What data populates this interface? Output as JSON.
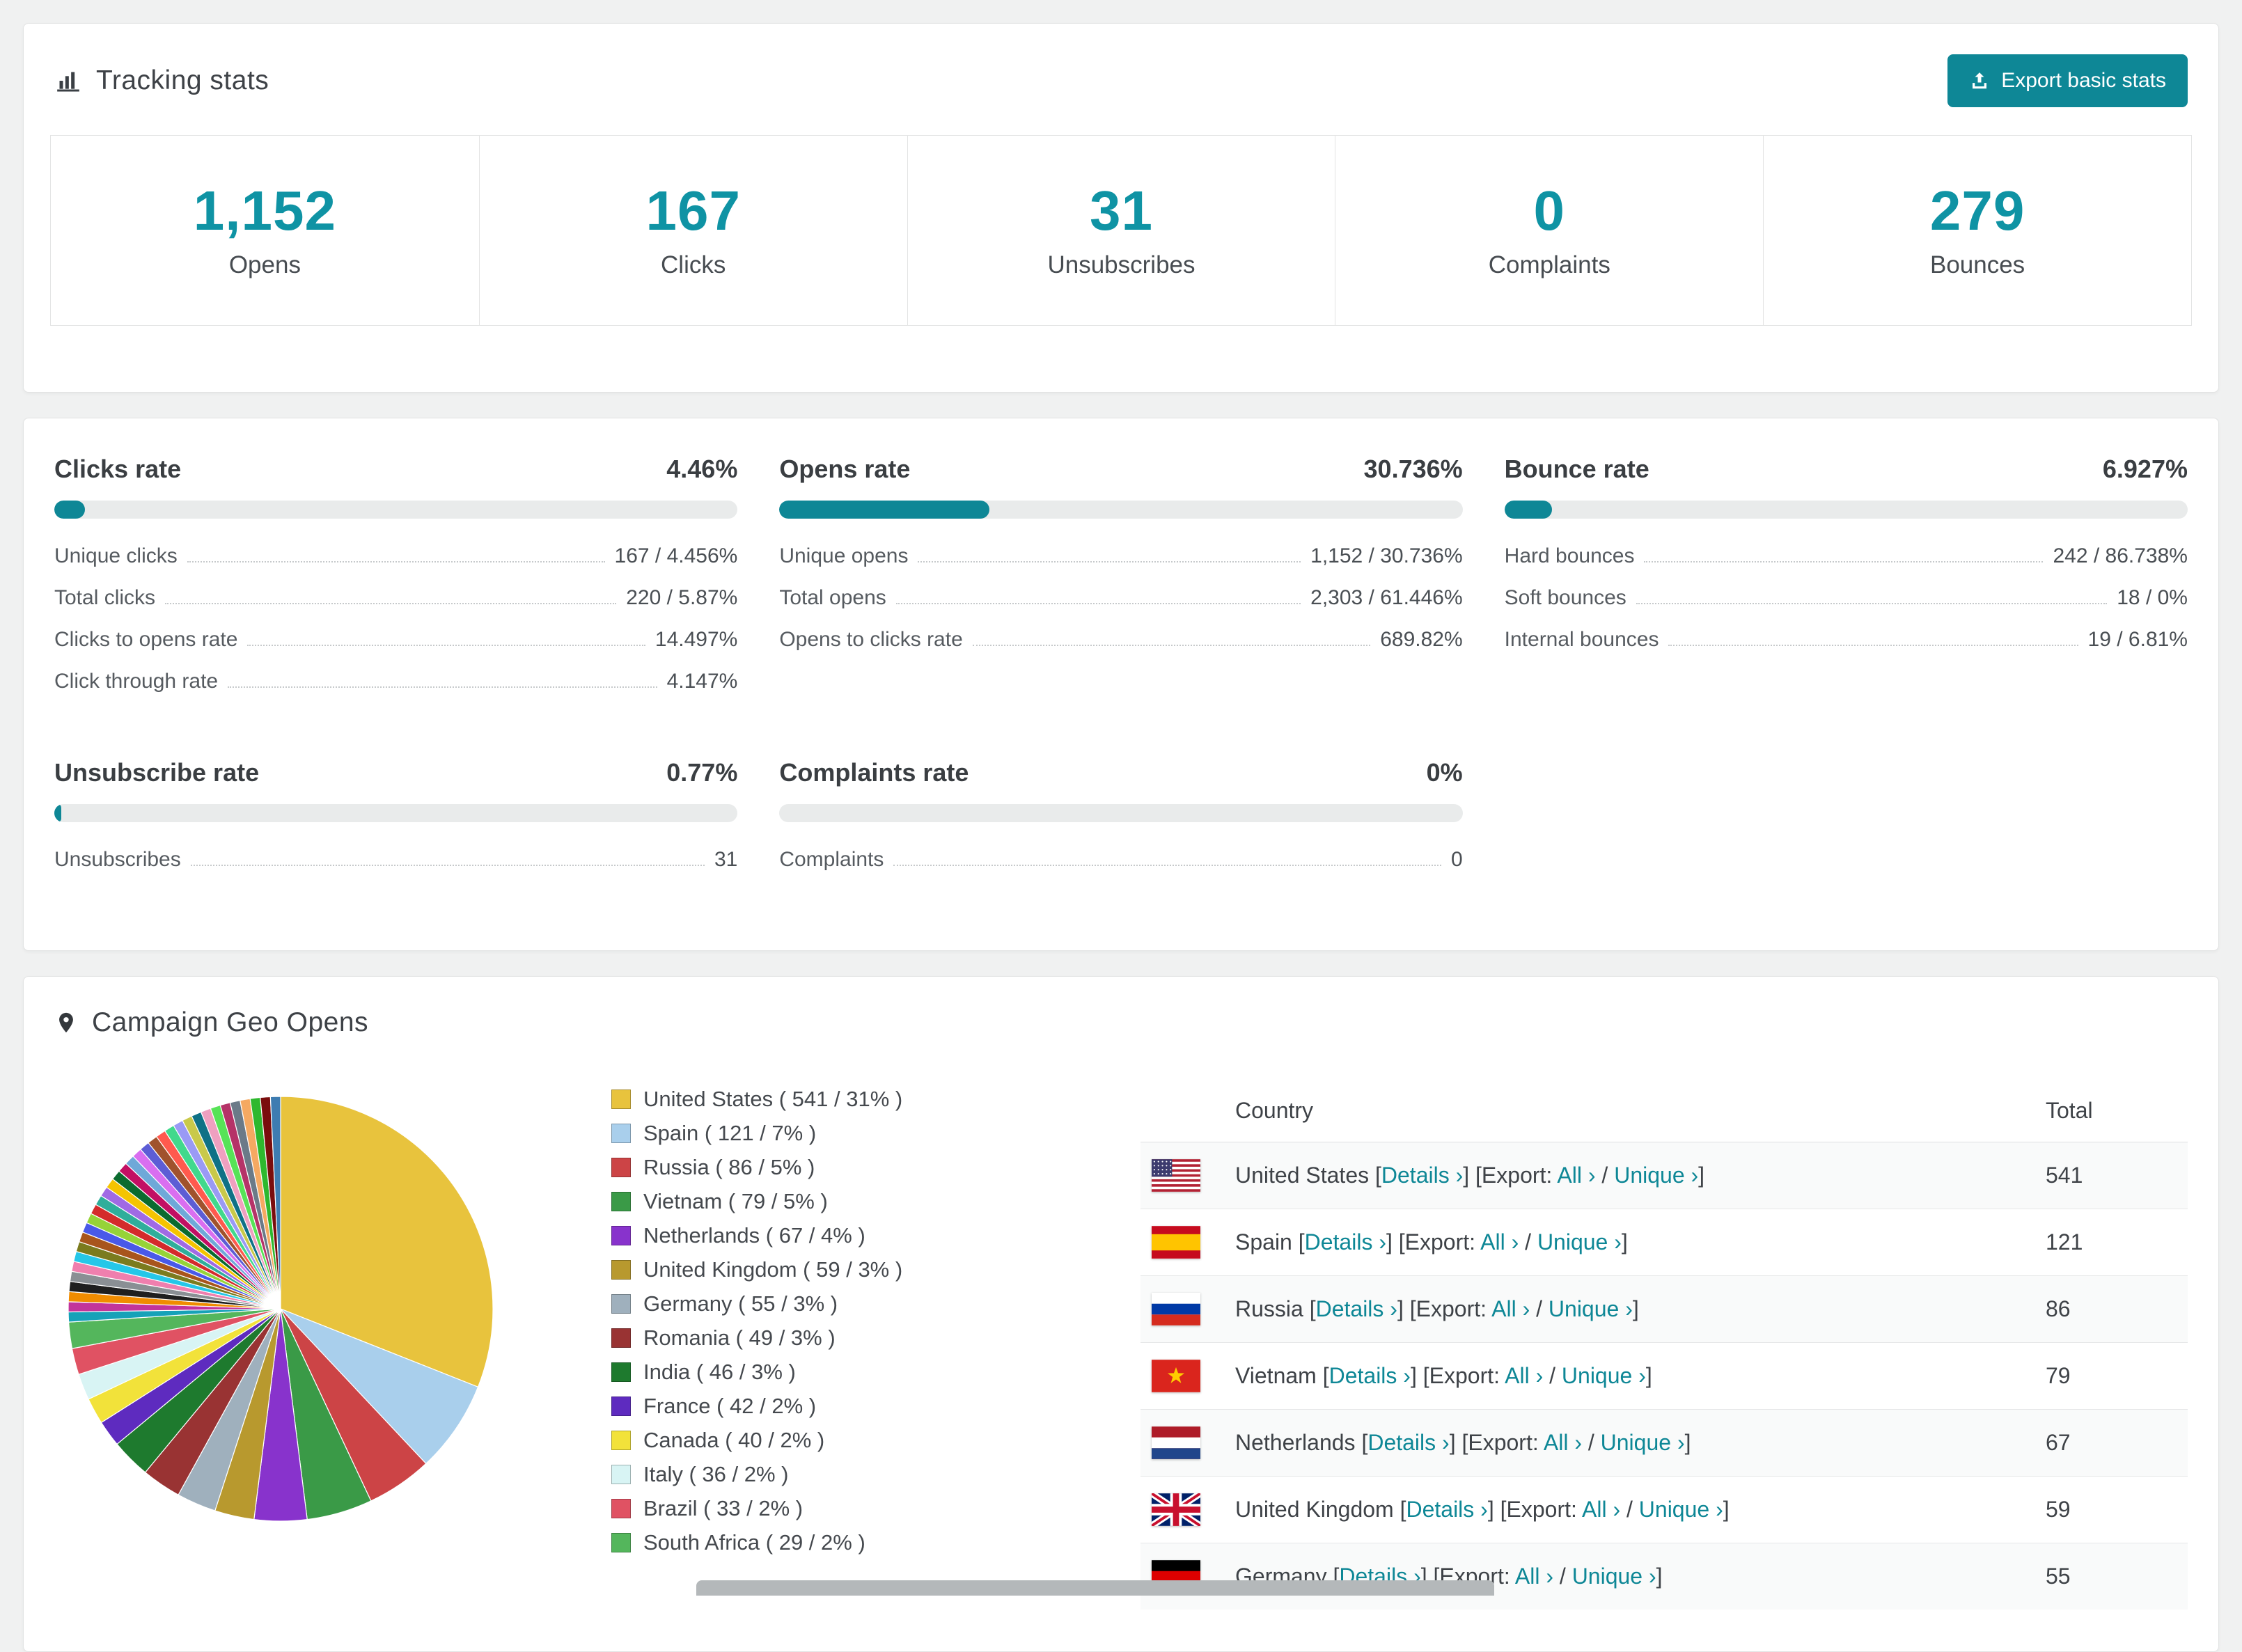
{
  "colors": {
    "accent": "#0e8796",
    "stat_number": "#0f93a4"
  },
  "tracking": {
    "title": "Tracking stats",
    "export_button_label": "Export basic stats",
    "stats": [
      {
        "value": "1,152",
        "label": "Opens"
      },
      {
        "value": "167",
        "label": "Clicks"
      },
      {
        "value": "31",
        "label": "Unsubscribes"
      },
      {
        "value": "0",
        "label": "Complaints"
      },
      {
        "value": "279",
        "label": "Bounces"
      }
    ]
  },
  "rates": {
    "panels": [
      {
        "title": "Clicks rate",
        "value": "4.46%",
        "progress": 4.46,
        "rows": [
          {
            "label": "Unique clicks",
            "value": "167 / 4.456%"
          },
          {
            "label": "Total clicks",
            "value": "220 / 5.87%"
          },
          {
            "label": "Clicks to opens rate",
            "value": "14.497%"
          },
          {
            "label": "Click through rate",
            "value": "4.147%"
          }
        ]
      },
      {
        "title": "Opens rate",
        "value": "30.736%",
        "progress": 30.736,
        "rows": [
          {
            "label": "Unique opens",
            "value": "1,152 / 30.736%"
          },
          {
            "label": "Total opens",
            "value": "2,303 / 61.446%"
          },
          {
            "label": "Opens to clicks rate",
            "value": "689.82%"
          }
        ]
      },
      {
        "title": "Bounce rate",
        "value": "6.927%",
        "progress": 6.927,
        "rows": [
          {
            "label": "Hard bounces",
            "value": "242 / 86.738%"
          },
          {
            "label": "Soft bounces",
            "value": "18 / 0%"
          },
          {
            "label": "Internal bounces",
            "value": "19 / 6.81%"
          }
        ]
      },
      {
        "title": "Unsubscribe rate",
        "value": "0.77%",
        "progress": 0.77,
        "rows": [
          {
            "label": "Unsubscribes",
            "value": "31"
          }
        ]
      },
      {
        "title": "Complaints rate",
        "value": "0%",
        "progress": 0,
        "rows": [
          {
            "label": "Complaints",
            "value": "0"
          }
        ]
      }
    ]
  },
  "geo": {
    "title": "Campaign Geo Opens",
    "table": {
      "columns": [
        "Country",
        "Total"
      ],
      "links": {
        "details": "Details ›",
        "export_prefix": "Export:",
        "all": "All ›",
        "unique": "Unique ›"
      },
      "punctuation": {
        "open": "[",
        "close": "]",
        "separator": "/"
      },
      "rows": [
        {
          "country": "United States",
          "flag": "us",
          "total": "541"
        },
        {
          "country": "Spain",
          "flag": "es",
          "total": "121"
        },
        {
          "country": "Russia",
          "flag": "ru",
          "total": "86"
        },
        {
          "country": "Vietnam",
          "flag": "vn",
          "total": "79"
        },
        {
          "country": "Netherlands",
          "flag": "nl",
          "total": "67"
        },
        {
          "country": "United Kingdom",
          "flag": "gb",
          "total": "59"
        },
        {
          "country": "Germany",
          "flag": "de",
          "total": "55"
        }
      ]
    }
  },
  "chart_data": {
    "type": "pie",
    "title": "Campaign Geo Opens",
    "unit": "opens",
    "slices": [
      {
        "label": "United States",
        "value": 541,
        "percent": 31,
        "color": "#e8c33d"
      },
      {
        "label": "Spain",
        "value": 121,
        "percent": 7,
        "color": "#a9cfec"
      },
      {
        "label": "Russia",
        "value": 86,
        "percent": 5,
        "color": "#cc4446"
      },
      {
        "label": "Vietnam",
        "value": 79,
        "percent": 5,
        "color": "#3a9a47"
      },
      {
        "label": "Netherlands",
        "value": 67,
        "percent": 4,
        "color": "#8833cc"
      },
      {
        "label": "United Kingdom",
        "value": 59,
        "percent": 3,
        "color": "#b8992e"
      },
      {
        "label": "Germany",
        "value": 55,
        "percent": 3,
        "color": "#9fb0bd"
      },
      {
        "label": "Romania",
        "value": 49,
        "percent": 3,
        "color": "#993333"
      },
      {
        "label": "India",
        "value": 46,
        "percent": 3,
        "color": "#1e7a2e"
      },
      {
        "label": "France",
        "value": 42,
        "percent": 2,
        "color": "#5e2bbf"
      },
      {
        "label": "Canada",
        "value": 40,
        "percent": 2,
        "color": "#f2e23a"
      },
      {
        "label": "Italy",
        "value": 36,
        "percent": 2,
        "color": "#d8f4f4"
      },
      {
        "label": "Brazil",
        "value": 33,
        "percent": 2,
        "color": "#e05263"
      },
      {
        "label": "South Africa",
        "value": 29,
        "percent": 2,
        "color": "#54b65c"
      }
    ],
    "other_share_percent": 26,
    "other_colors": [
      "#16a2b8",
      "#c2349b",
      "#f08c00",
      "#1f1f1f",
      "#8a8f94",
      "#ef7fae",
      "#25c7e8",
      "#7b7b1e",
      "#a8551c",
      "#4959e8",
      "#96d338",
      "#d42b2b",
      "#2fae9b",
      "#a06ae4",
      "#f5c400",
      "#0b6b2f",
      "#c20f63",
      "#6fa8d8",
      "#d96ef0",
      "#5d5dd5",
      "#a0522d",
      "#ff5a4e",
      "#41d98c",
      "#9a9af5",
      "#c9c94a",
      "#0f7186",
      "#efa0c0",
      "#57e357",
      "#b53368",
      "#6b7a88",
      "#f5a962",
      "#2eb82e",
      "#7a0d0d",
      "#3e7cb1"
    ]
  }
}
